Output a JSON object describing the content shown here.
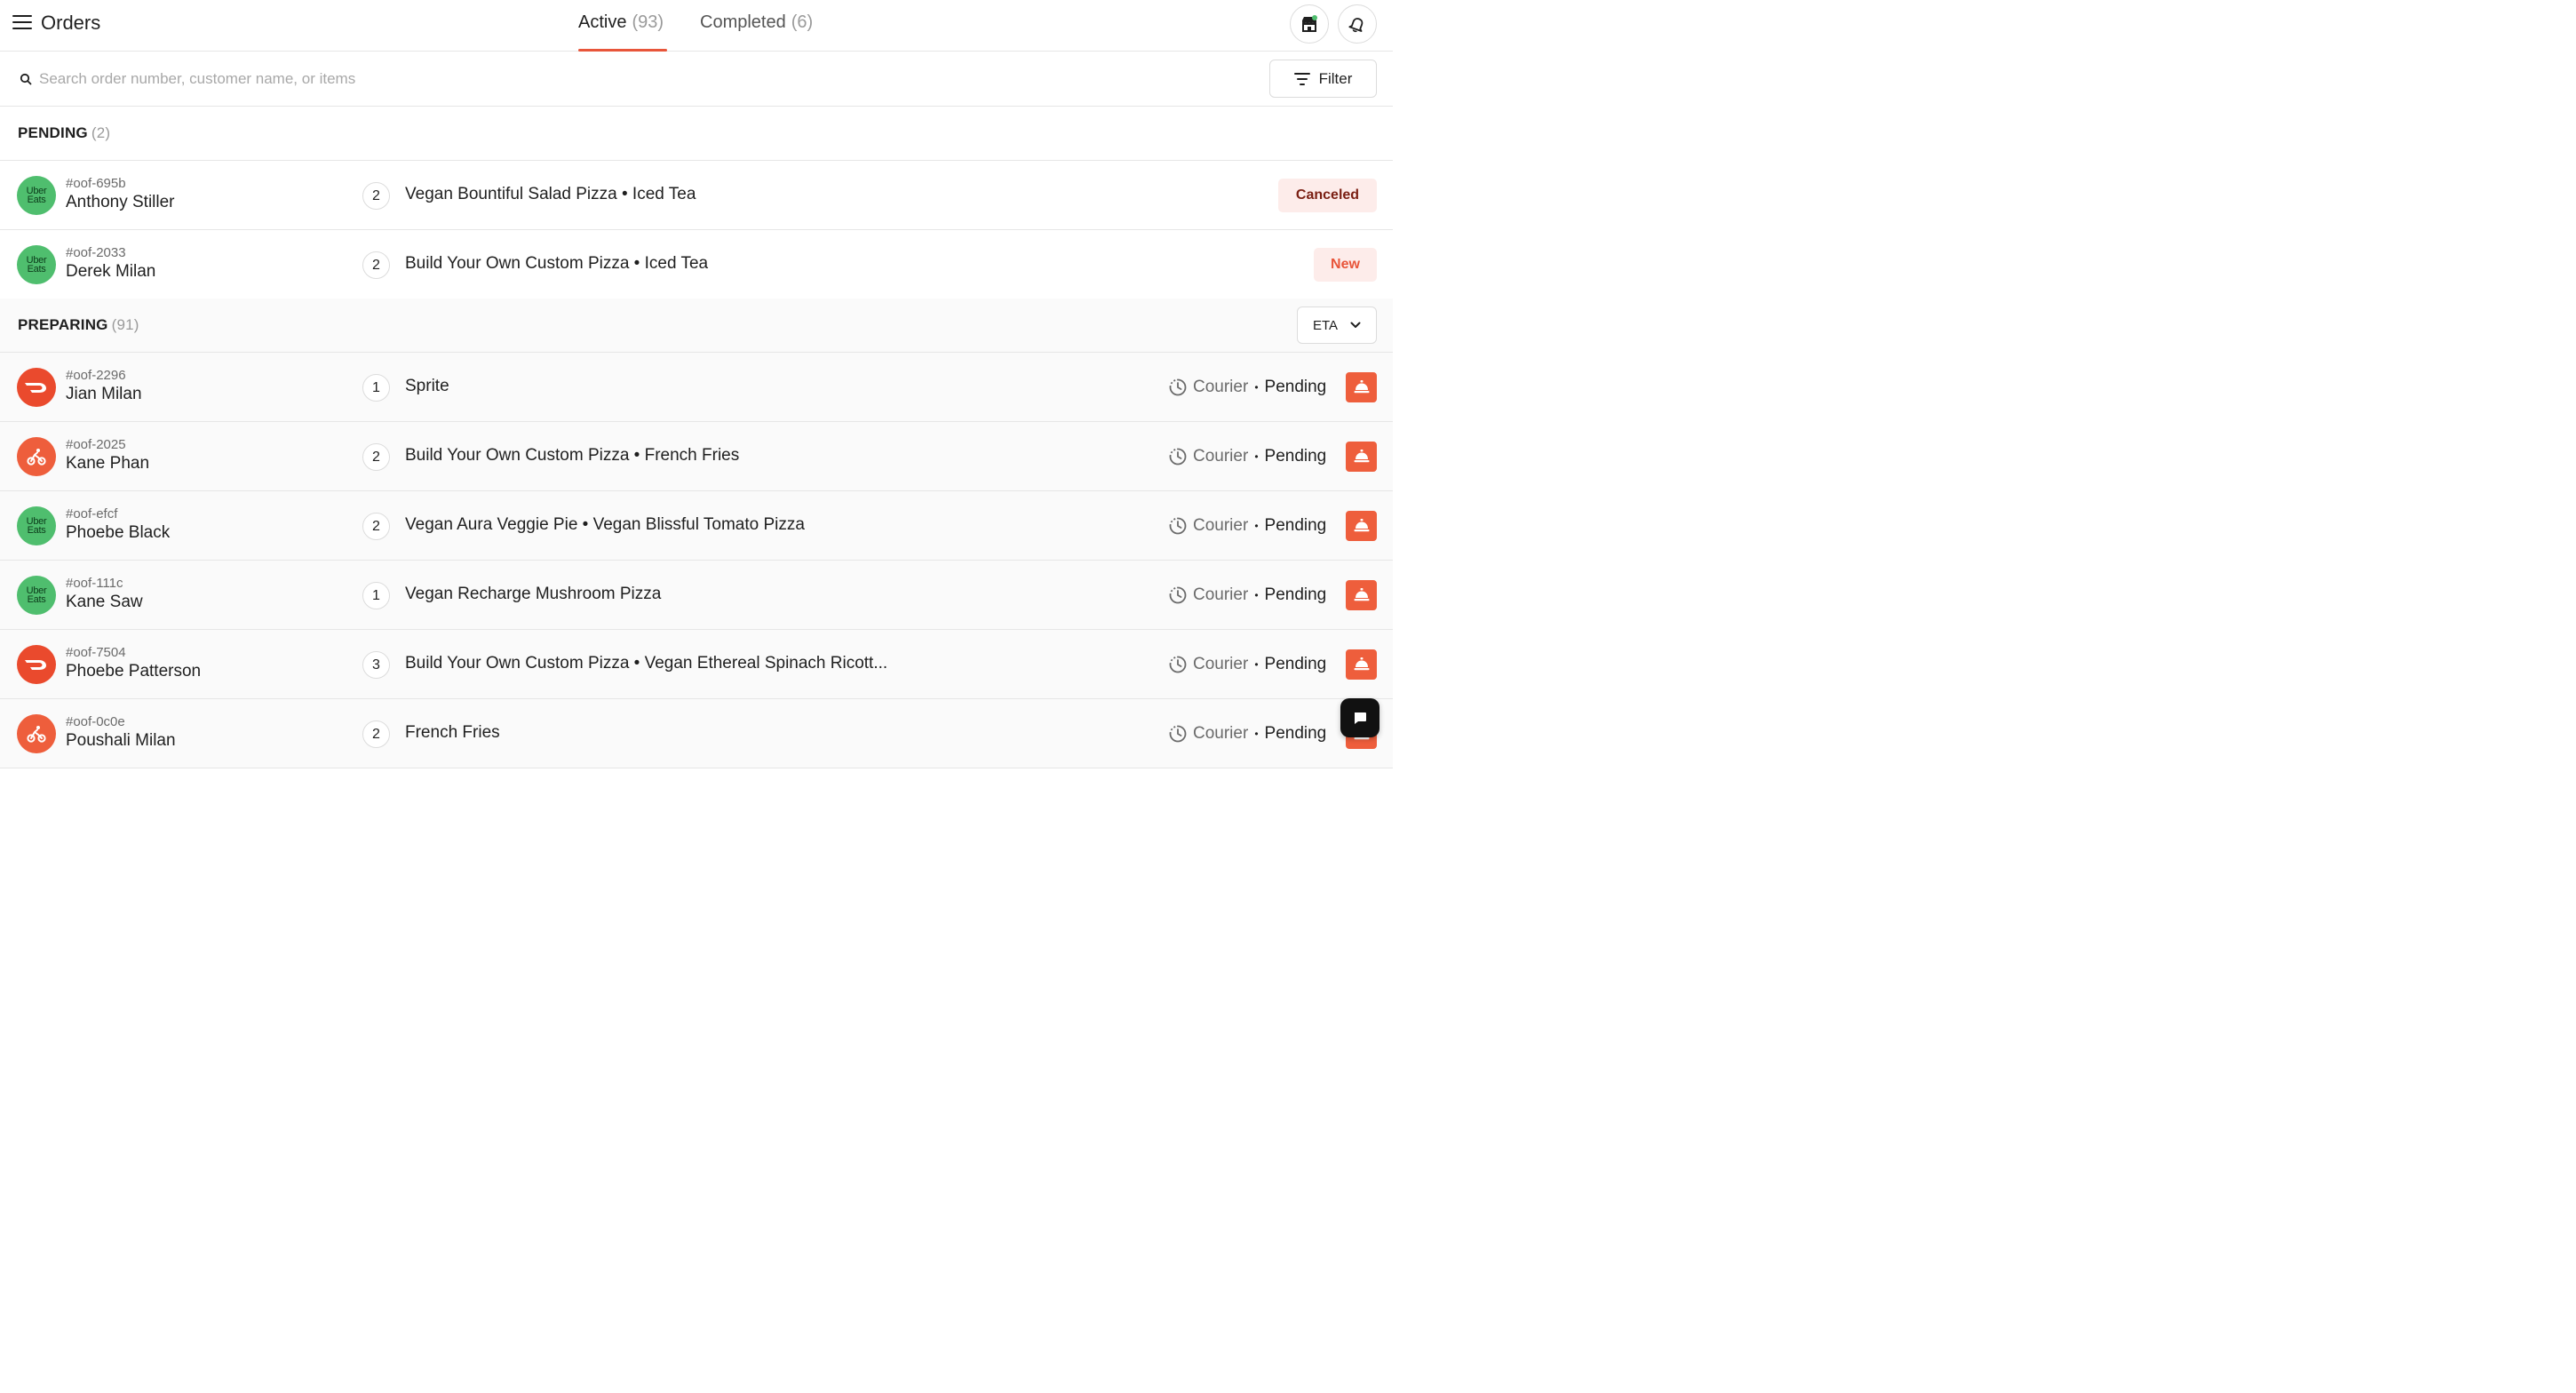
{
  "header": {
    "title": "Orders",
    "tabs": [
      {
        "label": "Active",
        "count": "(93)"
      },
      {
        "label": "Completed",
        "count": "(6)"
      }
    ],
    "icons": {
      "menu": "hamburger-icon",
      "store": "store-icon",
      "bell": "bell-icon"
    }
  },
  "search": {
    "placeholder": "Search order number, customer name, or items",
    "value": ""
  },
  "filter": {
    "label": "Filter"
  },
  "pending": {
    "title": "PENDING",
    "count": "(2)",
    "orders": [
      {
        "id": "#oof-695b",
        "customer": "Anthony Stiller",
        "qty": "2",
        "items": "Vegan Bountiful Salad Pizza • Iced Tea",
        "badge": "Canceled",
        "provider": "uber"
      },
      {
        "id": "#oof-2033",
        "customer": "Derek Milan",
        "qty": "2",
        "items": "Build Your Own Custom Pizza • Iced Tea",
        "badge": "New",
        "provider": "uber"
      }
    ]
  },
  "preparing": {
    "title": "PREPARING",
    "count": "(91)",
    "sort_label": "ETA",
    "courier_label": "Courier",
    "separator": "•",
    "status_label": "Pending",
    "orders": [
      {
        "id": "#oof-2296",
        "customer": "Jian Milan",
        "qty": "1",
        "items": "Sprite",
        "provider": "doordash"
      },
      {
        "id": "#oof-2025",
        "customer": "Kane Phan",
        "qty": "2",
        "items": "Build Your Own Custom Pizza • French Fries",
        "provider": "bike"
      },
      {
        "id": "#oof-efcf",
        "customer": "Phoebe Black",
        "qty": "2",
        "items": "Vegan Aura Veggie Pie • Vegan Blissful Tomato Pizza",
        "provider": "uber"
      },
      {
        "id": "#oof-111c",
        "customer": "Kane Saw",
        "qty": "1",
        "items": "Vegan Recharge Mushroom Pizza",
        "provider": "uber"
      },
      {
        "id": "#oof-7504",
        "customer": "Phoebe Patterson",
        "qty": "3",
        "items": "Build Your Own Custom Pizza • Vegan Ethereal Spinach Ricott...",
        "provider": "doordash"
      },
      {
        "id": "#oof-0c0e",
        "customer": "Poushali Milan",
        "qty": "2",
        "items": "French Fries",
        "provider": "bike"
      }
    ]
  },
  "uber_logo": {
    "line1": "Uber",
    "line2": "Eats"
  },
  "colors": {
    "accent": "#e8553a",
    "uber": "#4fbe6e",
    "doordash": "#ea4a2d",
    "bike": "#ee5e3c"
  }
}
